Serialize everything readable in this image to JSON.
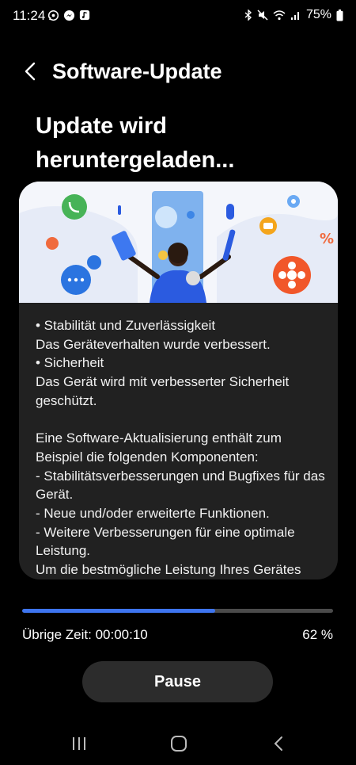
{
  "status_bar": {
    "time": "11:24",
    "left_icons": [
      "whatsapp-icon",
      "messenger-icon",
      "music-icon"
    ],
    "right_icons": [
      "bluetooth-icon",
      "mute-icon",
      "wifi-icon",
      "signal-icon"
    ],
    "battery": "75%"
  },
  "header": {
    "title": "Software-Update"
  },
  "heading": "Update wird heruntergeladen...",
  "release_notes": [
    "• Stabilität und Zuverlässigkeit",
    "Das Geräteverhalten wurde verbessert.",
    "• Sicherheit",
    "Das Gerät wird mit verbesserter Sicherheit geschützt.",
    "",
    "Eine Software-Aktualisierung enthält zum Beispiel die folgenden Komponenten:",
    " - Stabilitätsverbesserungen und Bugfixes für das Gerät.",
    " - Neue und/oder erweiterte Funktionen.",
    " - Weitere Verbesserungen für eine optimale Leistung.",
    "Um die bestmögliche Leistung Ihres Gerätes"
  ],
  "progress": {
    "fraction": 0.62
  },
  "remaining_time": "Übrige Zeit: 00:00:10",
  "percent": "62 %",
  "pause_label": "Pause",
  "navbar": [
    "recents-icon",
    "home-icon",
    "back-icon"
  ],
  "colors": {
    "progress": "#3e75f0",
    "track": "#4b4b4b",
    "card": "#212121"
  }
}
